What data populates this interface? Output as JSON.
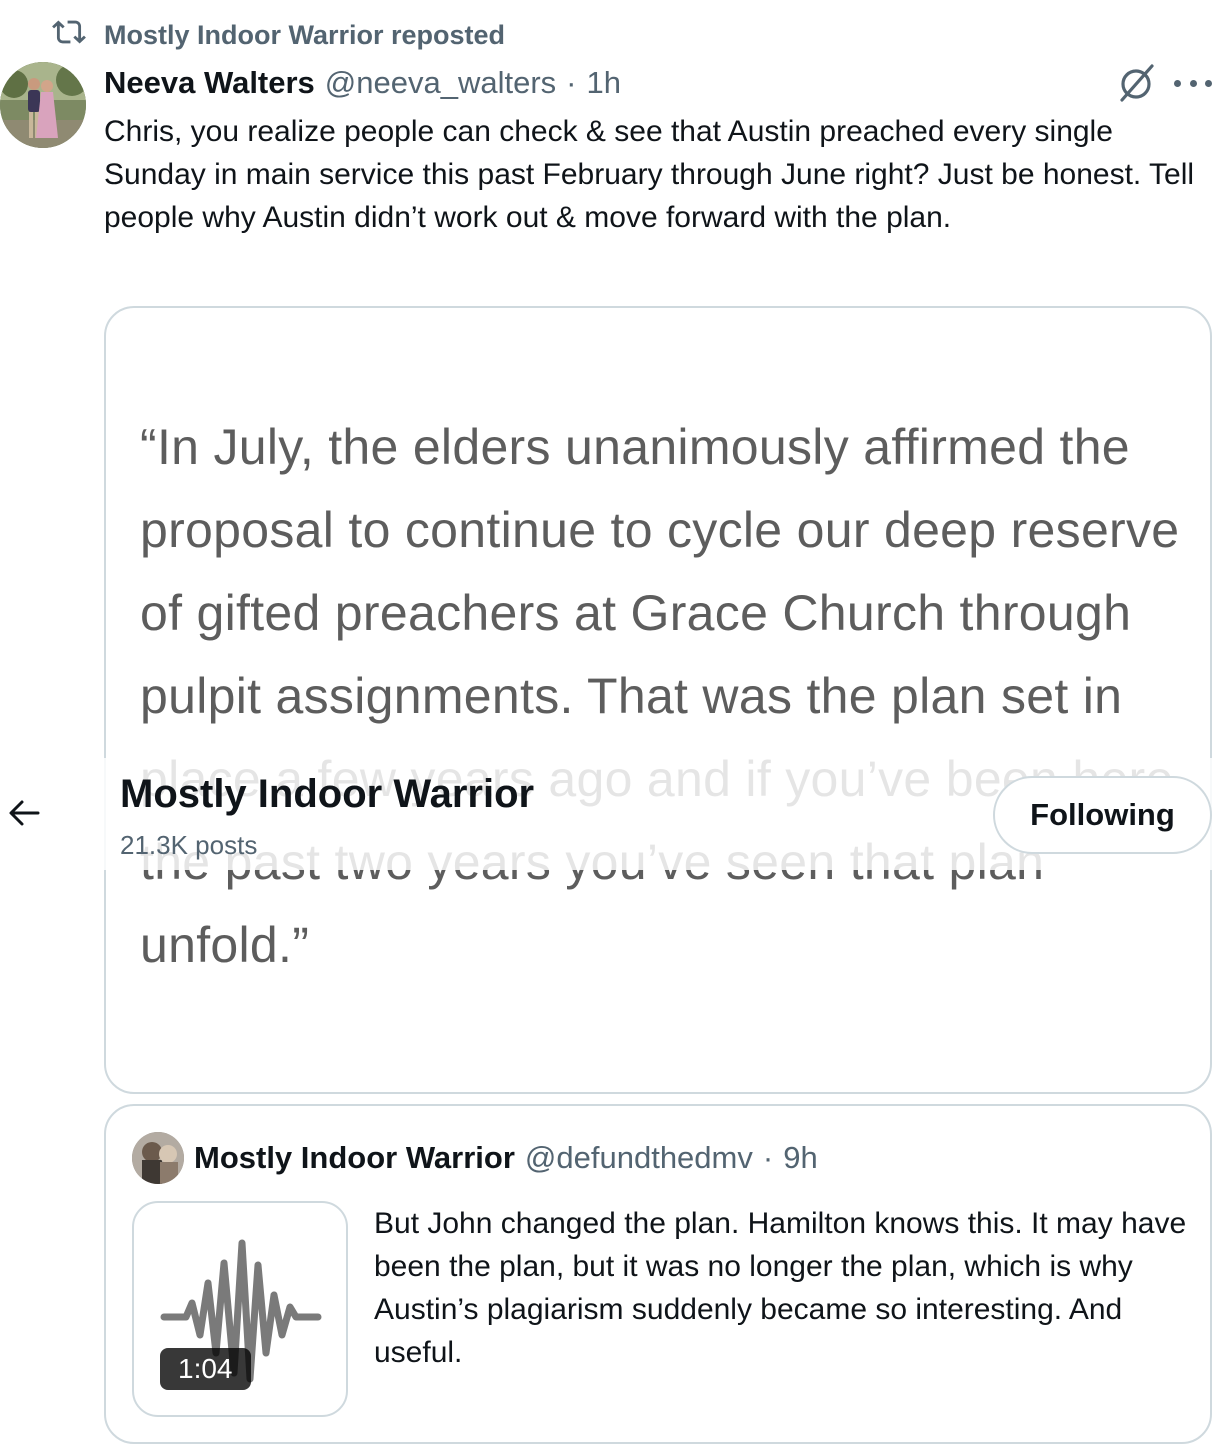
{
  "repost": {
    "label": "Mostly Indoor Warrior reposted",
    "icon": "repost-icon"
  },
  "post": {
    "author_name": "Neeva Walters",
    "author_handle": "@neeva_walters",
    "separator": "·",
    "time": "1h",
    "text": "Chris, you realize people can check & see that Austin preached every single Sunday in main service this past February through June right? Just be honest. Tell people why Austin didn’t work out & move forward with the plan.",
    "menu_icon": "more-icon",
    "grok_icon": "grok-icon"
  },
  "media": {
    "quote_image_text": "“In July, the elders unanimously affirmed the proposal to continue to cycle our deep reserve of gifted preachers at Grace Church through pulpit assignments. That was the plan set in place a few years ago and if you’ve been here the past two years you’ve seen that plan unfold.”"
  },
  "profile_header": {
    "name": "Mostly Indoor Warrior",
    "post_count": "21.3K posts",
    "following_label": "Following",
    "back_icon": "back-arrow-icon"
  },
  "quoted_post": {
    "author_name": "Mostly Indoor Warrior",
    "author_handle": "@defundthedmv",
    "separator": "·",
    "time": "9h",
    "audio_duration": "1:04",
    "text": "But John changed the plan. Hamilton knows this. It may have been the plan, but it was no longer the plan, which is why Austin’s plagiarism suddenly became so interesting. And useful."
  },
  "colors": {
    "text_primary": "#0f1419",
    "text_secondary": "#536471",
    "border": "#cfd9de",
    "image_text": "#5d5d5d"
  }
}
